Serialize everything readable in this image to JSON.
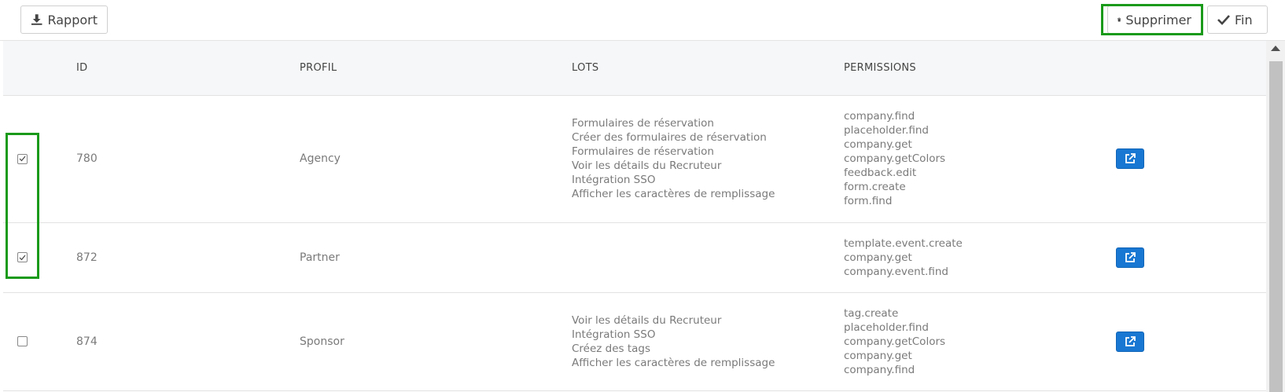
{
  "toolbar": {
    "report_label": "Rapport",
    "delete_label": "Supprimer",
    "finish_label": "Fin"
  },
  "table": {
    "headers": [
      "ID",
      "PROFIL",
      "LOTS",
      "PERMISSIONS"
    ],
    "rows": [
      {
        "checked": true,
        "id": "780",
        "profil": "Agency",
        "lots": [
          "Formulaires de réservation",
          "Créer des formulaires de réservation",
          "Formulaires de réservation",
          "Voir les détails du Recruteur",
          "Intégration SSO",
          "Afficher les caractères de remplissage"
        ],
        "permissions": [
          "company.find",
          "placeholder.find",
          "company.get",
          "company.getColors",
          "feedback.edit",
          "form.create",
          "form.find"
        ]
      },
      {
        "checked": true,
        "id": "872",
        "profil": "Partner",
        "lots": [],
        "permissions": [
          "template.event.create",
          "company.get",
          "company.event.find"
        ]
      },
      {
        "checked": false,
        "id": "874",
        "profil": "Sponsor",
        "lots": [
          "Voir les détails du Recruteur",
          "Intégration SSO",
          "Créez des tags",
          "Afficher les caractères de remplissage"
        ],
        "permissions": [
          "tag.create",
          "placeholder.find",
          "company.getColors",
          "company.get",
          "company.find"
        ]
      }
    ]
  },
  "colors": {
    "highlight": "#1a9a1a",
    "edit_button": "#1877d2"
  }
}
